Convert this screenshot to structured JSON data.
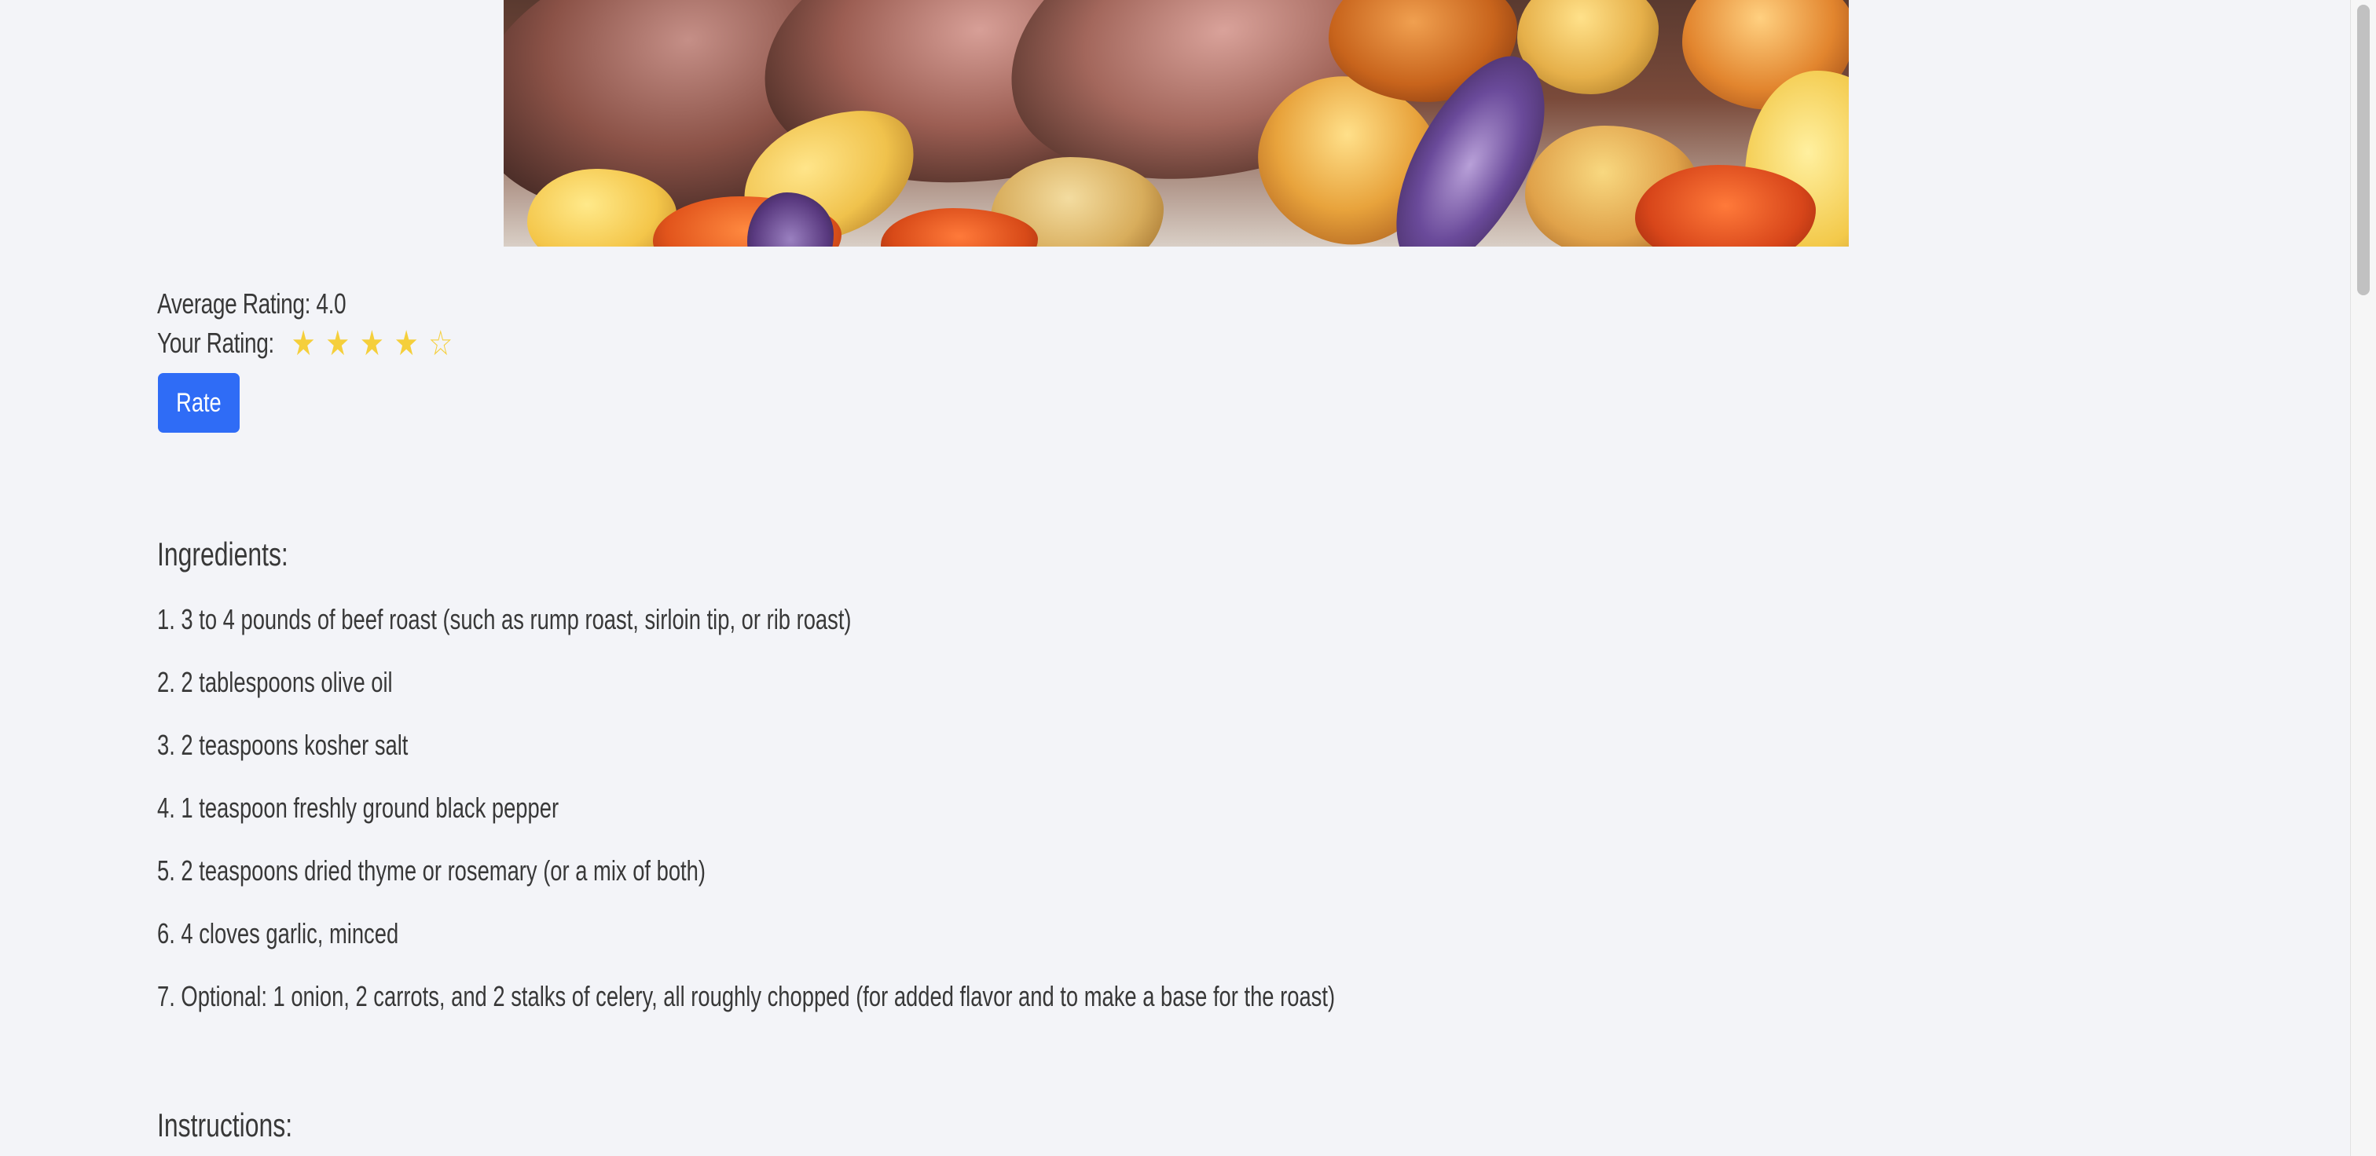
{
  "rating": {
    "average_label": "Average Rating: 4.0",
    "your_label": "Your Rating:",
    "your_value": 4,
    "max": 5,
    "star_color": "#f5cf3b"
  },
  "rate_button": {
    "label": "Rate",
    "color": "#2f6cf6"
  },
  "ingredients": {
    "title": "Ingredients:",
    "items": [
      "1. 3 to 4 pounds of beef roast (such as rump roast, sirloin tip, or rib roast)",
      "2. 2 tablespoons olive oil",
      "3. 2 teaspoons kosher salt",
      "4. 1 teaspoon freshly ground black pepper",
      "5. 2 teaspoons dried thyme or rosemary (or a mix of both)",
      "6. 4 cloves garlic, minced",
      "7. Optional: 1 onion, 2 carrots, and 2 stalks of celery, all roughly chopped (for added flavor and to make a base for the roast)"
    ]
  },
  "instructions": {
    "title": "Instructions:"
  }
}
